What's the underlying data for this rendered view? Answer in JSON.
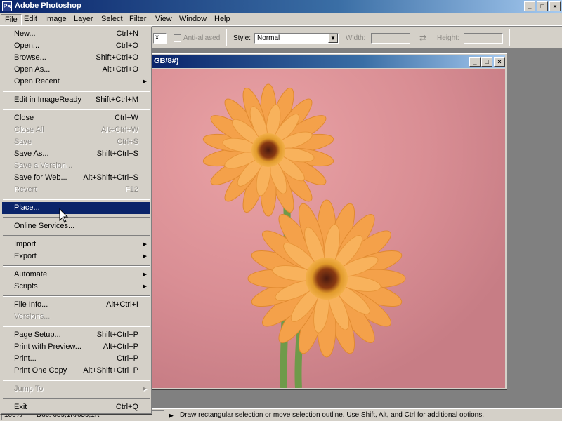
{
  "window": {
    "title": "Adobe Photoshop",
    "app_icon": "photoshop-app-icon",
    "controls": {
      "minimize": "_",
      "maximize": "□",
      "close": "×"
    }
  },
  "menubar": [
    "File",
    "Edit",
    "Image",
    "Layer",
    "Select",
    "Filter",
    "View",
    "Window",
    "Help"
  ],
  "options_bar": {
    "antialiased_label": "Anti-aliased",
    "style_label": "Style:",
    "style_value": "Normal",
    "width_label": "Width:",
    "height_label": "Height:",
    "swap_icon": "⇄",
    "feather_suffix": "x"
  },
  "document": {
    "title_fragment": "GB/8#)",
    "controls": {
      "minimize": "_",
      "maximize": "□",
      "close": "×"
    }
  },
  "status_bar": {
    "zoom": "100%",
    "doc_info": "Doc: 659,1K/659,1K",
    "arrow": "▶",
    "hint": "Draw rectangular selection or move selection outline.  Use Shift, Alt, and Ctrl for additional options."
  },
  "file_menu": {
    "groups": [
      [
        {
          "label": "New...",
          "shortcut": "Ctrl+N",
          "enabled": true
        },
        {
          "label": "Open...",
          "shortcut": "Ctrl+O",
          "enabled": true
        },
        {
          "label": "Browse...",
          "shortcut": "Shift+Ctrl+O",
          "enabled": true
        },
        {
          "label": "Open As...",
          "shortcut": "Alt+Ctrl+O",
          "enabled": true
        },
        {
          "label": "Open Recent",
          "shortcut": "",
          "submenu": true,
          "enabled": true
        }
      ],
      [
        {
          "label": "Edit in ImageReady",
          "shortcut": "Shift+Ctrl+M",
          "enabled": true
        }
      ],
      [
        {
          "label": "Close",
          "shortcut": "Ctrl+W",
          "enabled": true
        },
        {
          "label": "Close All",
          "shortcut": "Alt+Ctrl+W",
          "enabled": false
        },
        {
          "label": "Save",
          "shortcut": "Ctrl+S",
          "enabled": false
        },
        {
          "label": "Save As...",
          "shortcut": "Shift+Ctrl+S",
          "enabled": true
        },
        {
          "label": "Save a Version...",
          "shortcut": "",
          "enabled": false
        },
        {
          "label": "Save for Web...",
          "shortcut": "Alt+Shift+Ctrl+S",
          "enabled": true
        },
        {
          "label": "Revert",
          "shortcut": "F12",
          "enabled": false
        }
      ],
      [
        {
          "label": "Place...",
          "shortcut": "",
          "enabled": true,
          "selected": true
        }
      ],
      [
        {
          "label": "Online Services...",
          "shortcut": "",
          "enabled": true
        }
      ],
      [
        {
          "label": "Import",
          "shortcut": "",
          "submenu": true,
          "enabled": true
        },
        {
          "label": "Export",
          "shortcut": "",
          "submenu": true,
          "enabled": true
        }
      ],
      [
        {
          "label": "Automate",
          "shortcut": "",
          "submenu": true,
          "enabled": true
        },
        {
          "label": "Scripts",
          "shortcut": "",
          "submenu": true,
          "enabled": true
        }
      ],
      [
        {
          "label": "File Info...",
          "shortcut": "Alt+Ctrl+I",
          "enabled": true
        },
        {
          "label": "Versions...",
          "shortcut": "",
          "enabled": false
        }
      ],
      [
        {
          "label": "Page Setup...",
          "shortcut": "Shift+Ctrl+P",
          "enabled": true
        },
        {
          "label": "Print with Preview...",
          "shortcut": "Alt+Ctrl+P",
          "enabled": true
        },
        {
          "label": "Print...",
          "shortcut": "Ctrl+P",
          "enabled": true
        },
        {
          "label": "Print One Copy",
          "shortcut": "Alt+Shift+Ctrl+P",
          "enabled": true
        }
      ],
      [
        {
          "label": "Jump To",
          "shortcut": "",
          "submenu": true,
          "enabled": false
        }
      ],
      [
        {
          "label": "Exit",
          "shortcut": "Ctrl+Q",
          "enabled": true
        }
      ]
    ],
    "submenu_glyph": "▶"
  },
  "colors": {
    "titlebar_start": "#0a246a",
    "titlebar_end": "#a6caf0",
    "face": "#d4d0c8",
    "selection": "#0a246a",
    "disabled_text": "#8d8a85",
    "workspace": "#808080"
  }
}
